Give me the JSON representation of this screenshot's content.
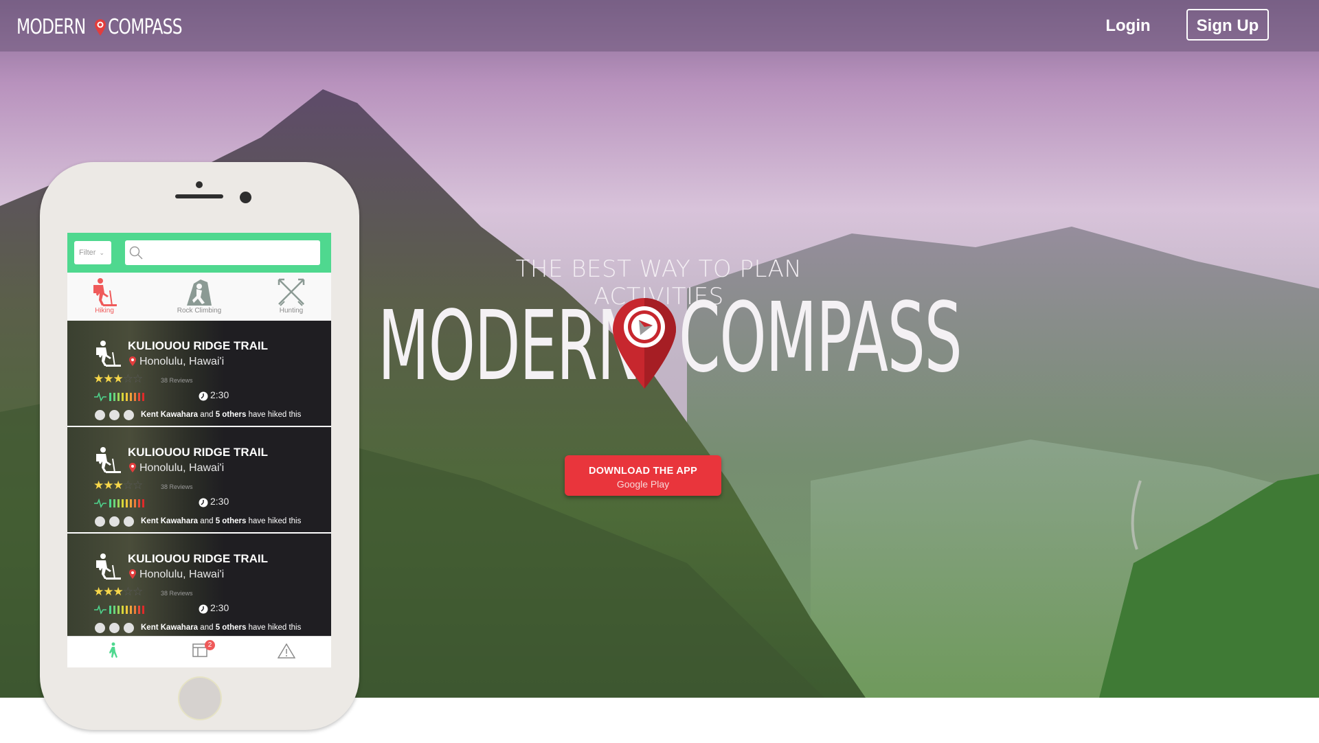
{
  "header": {
    "logo_text": "MODERN",
    "logo_text_2": "COMPASS",
    "login_label": "Login",
    "signup_label": "Sign Up"
  },
  "hero": {
    "tagline": "THE BEST WAY TO PLAN ACTIVITIES",
    "title_part1": "MODERN",
    "title_part2": "COMPASS",
    "cta_label": "DOWNLOAD THE APP",
    "cta_sub": "Google Play"
  },
  "phone": {
    "filter_label": "Filter",
    "search_placeholder": "",
    "categories": [
      {
        "label": "Hiking",
        "icon": "hiker-icon",
        "active": true
      },
      {
        "label": "Rock Climbing",
        "icon": "climber-icon",
        "active": false
      },
      {
        "label": "Hunting",
        "icon": "crossed-arrows-icon",
        "active": false
      }
    ],
    "cards": [
      {
        "name": "KULIOUOU RIDGE TRAIL",
        "location": "Honolulu, Hawai'i",
        "rating": 3,
        "reviews": "38 Reviews",
        "time": "2:30",
        "social_name": "Kent Kawahara",
        "social_and": "and",
        "social_others": "5 others",
        "social_tail": "have hiked this"
      },
      {
        "name": "KULIOUOU RIDGE TRAIL",
        "location": "Honolulu, Hawai'i",
        "rating": 3,
        "reviews": "38 Reviews",
        "time": "2:30",
        "social_name": "Kent Kawahara",
        "social_and": "and",
        "social_others": "5 others",
        "social_tail": "have hiked this"
      },
      {
        "name": "KULIOUOU RIDGE TRAIL",
        "location": "Honolulu, Hawai'i",
        "rating": 3,
        "reviews": "38 Reviews",
        "time": "2:30",
        "social_name": "Kent Kawahara",
        "social_and": "and",
        "social_others": "5 others",
        "social_tail": "have hiked this"
      }
    ],
    "tabbar": {
      "badge_count": "2",
      "icons": [
        "walker-icon",
        "map-icon",
        "warning-icon"
      ]
    }
  },
  "colors": {
    "accent_red": "#e9353c",
    "app_green": "#4fd88f",
    "active_category": "#ef5a5a",
    "star_yellow": "#f7d74a"
  }
}
